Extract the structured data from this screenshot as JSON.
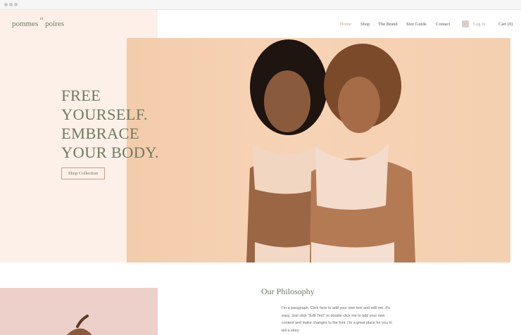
{
  "header": {
    "logo_main": "pommes",
    "logo_et": "et",
    "logo_end": "poires",
    "nav": [
      {
        "label": "Home",
        "active": true
      },
      {
        "label": "Shop"
      },
      {
        "label": "The Brand"
      },
      {
        "label": "Size Guide"
      },
      {
        "label": "Contact"
      }
    ],
    "login_label": "Log In",
    "cart_label": "Cart (0)"
  },
  "hero": {
    "heading_lines": [
      "FREE",
      "YOURSELF.",
      "EMBRACE",
      "YOUR BODY."
    ],
    "cta_label": "Shop Collection",
    "image_description": "two women in nude lingerie against peach backdrop"
  },
  "philosophy": {
    "title": "Our Philosophy",
    "body": "I'm a paragraph. Click here to add your own text and edit me. It's easy. Just click \"Edit Text\" or double click me to add your own content and make changes to the font. I'm a great place for you to tell a story"
  },
  "colors": {
    "accent_green": "#6f7a60",
    "panel_bg": "#fdf0e8",
    "hero_bg": "#f6d2b4",
    "nav_active": "#c7a07e"
  }
}
